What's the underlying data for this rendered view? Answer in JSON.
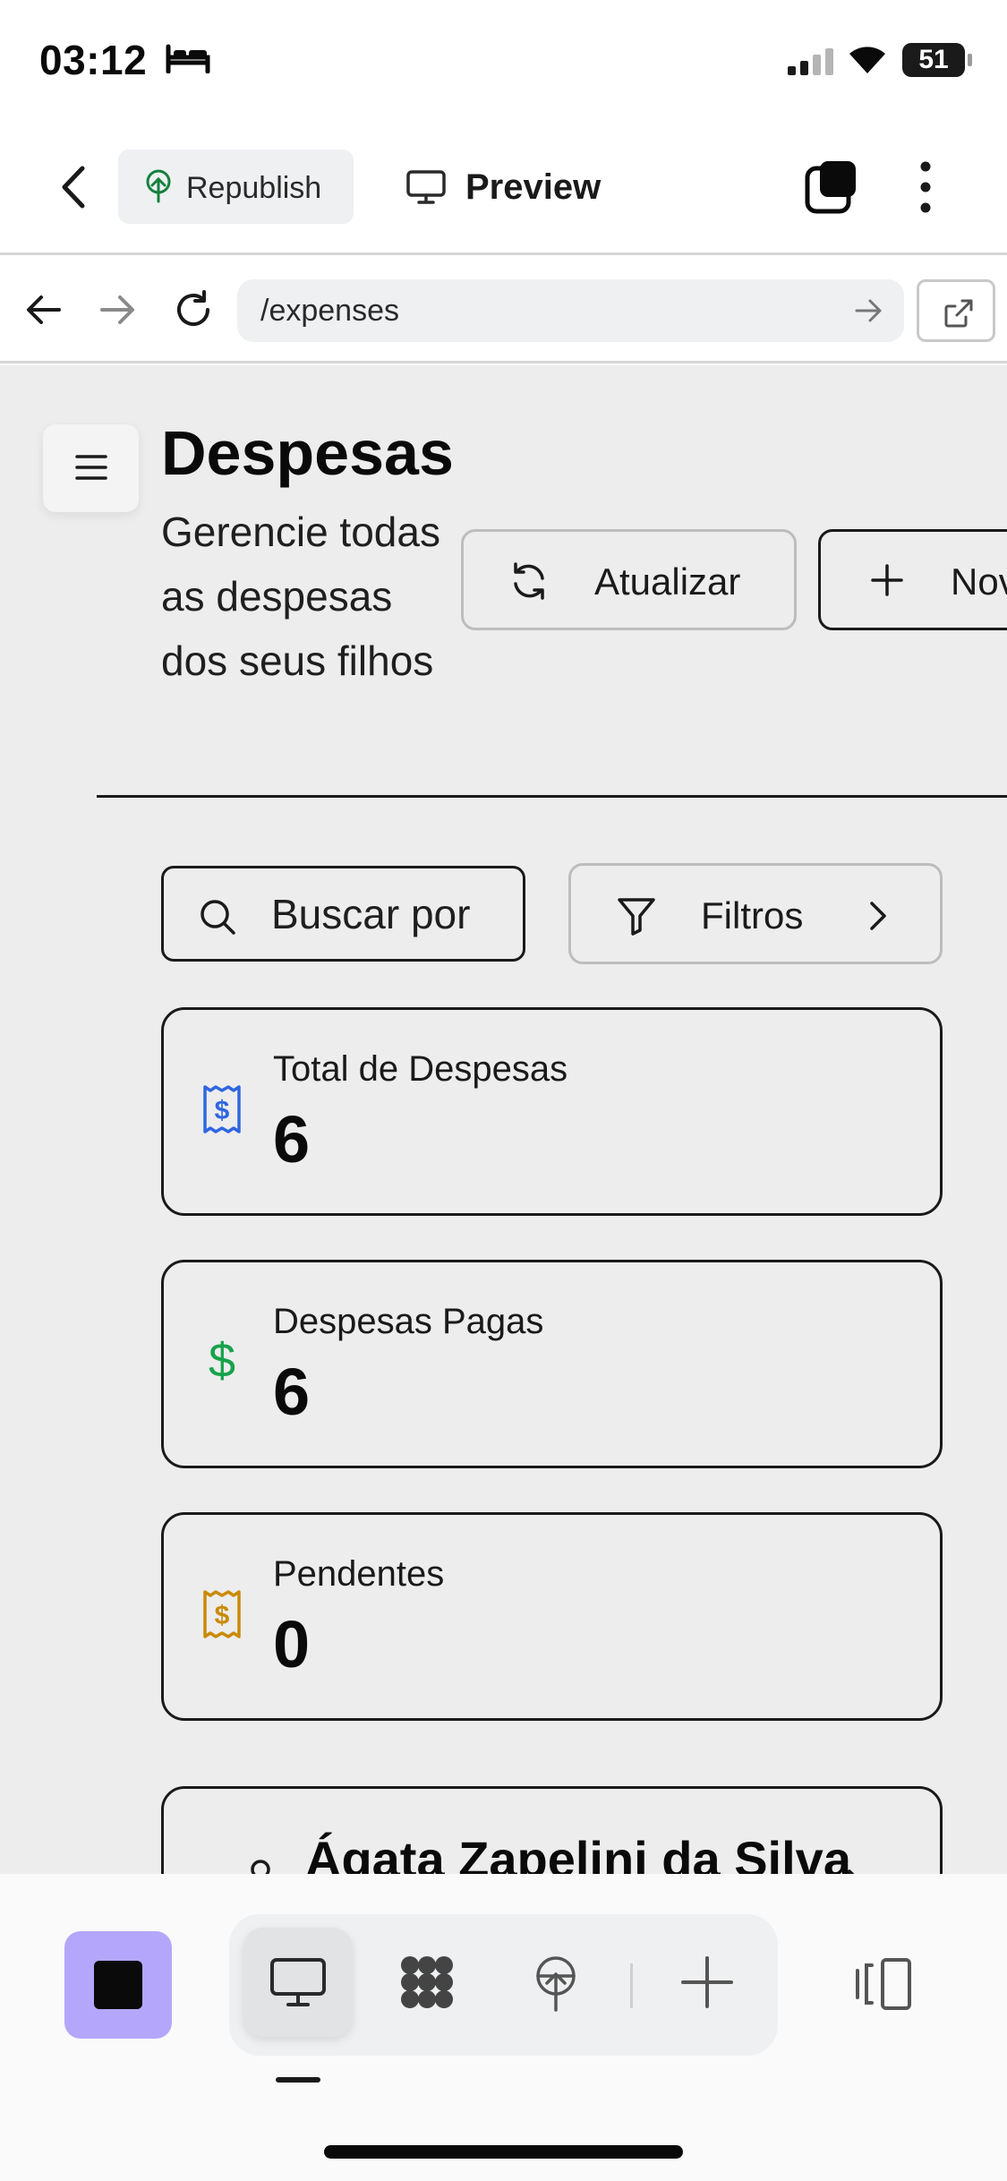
{
  "status_bar": {
    "time": "03:12",
    "battery": "51"
  },
  "toolbar": {
    "republish_label": "Republish",
    "preview_label": "Preview"
  },
  "address_bar": {
    "url": "/expenses"
  },
  "page": {
    "title": "Despesas",
    "subtitle": "Gerencie todas as despesas dos seus filhos",
    "refresh_label": "Atualizar",
    "new_label": "Nov"
  },
  "filters": {
    "search_placeholder": "Buscar por",
    "filters_label": "Filtros"
  },
  "stats": [
    {
      "label": "Total de Despesas",
      "value": "6",
      "icon": "receipt-icon",
      "color": "#2f66e0"
    },
    {
      "label": "Despesas Pagas",
      "value": "6",
      "icon": "dollar-icon",
      "color": "#16a34a"
    },
    {
      "label": "Pendentes",
      "value": "0",
      "icon": "receipt-icon",
      "color": "#ca8a04"
    }
  ],
  "children": [
    {
      "name": "Ágata Zapelini da Silva"
    }
  ],
  "colors": {
    "accent_purple": "#b4a6fb",
    "republish_green": "#15803d"
  }
}
